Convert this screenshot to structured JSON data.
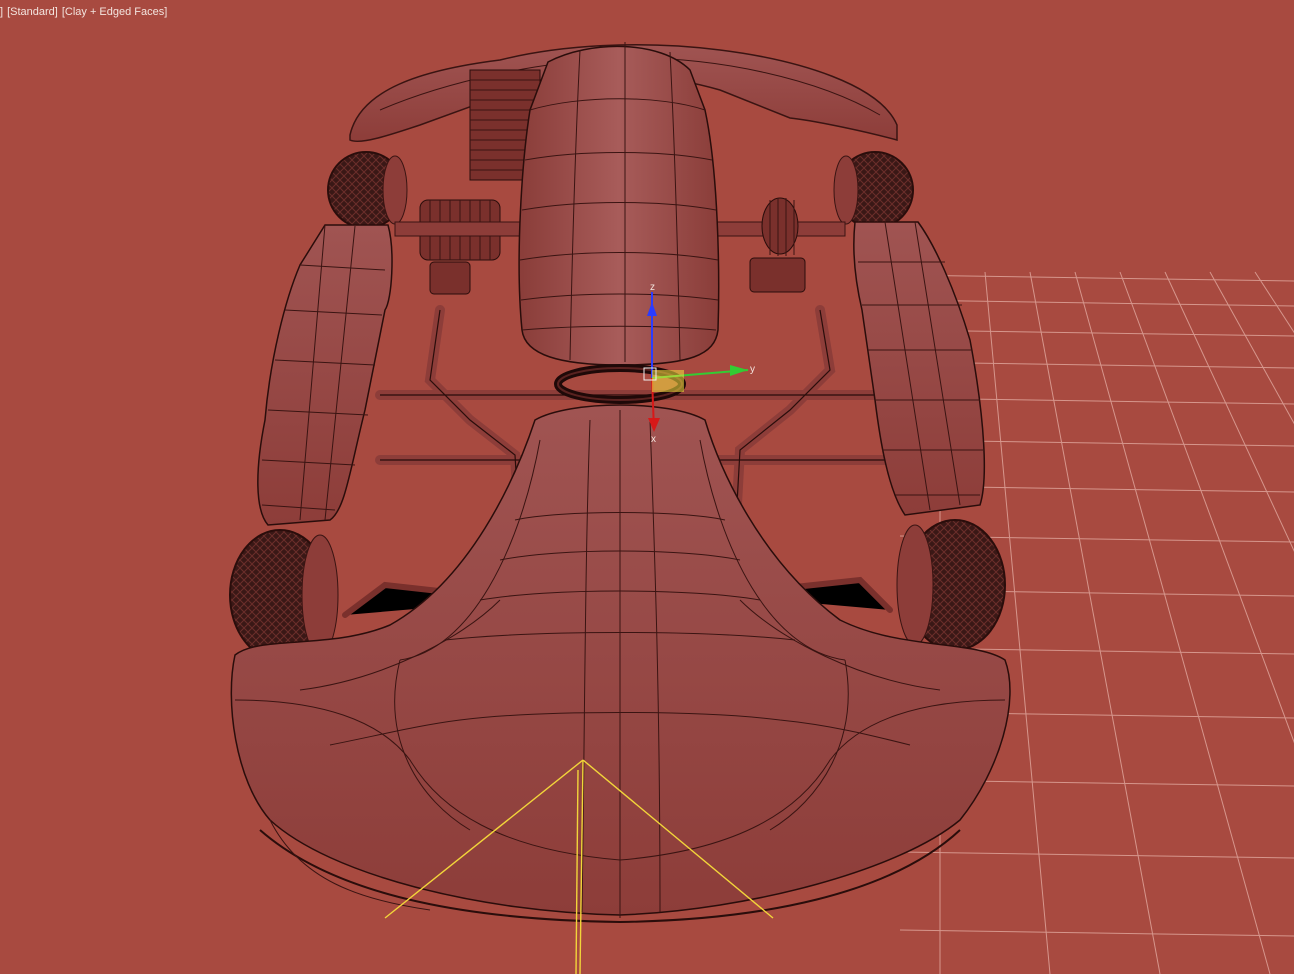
{
  "viewport": {
    "label_prefix": "]",
    "label_shading": "[Standard]",
    "label_style": "[Clay + Edged Faces]",
    "background_color": "#a84a40",
    "grid_color": "#d6968c",
    "model_color": "#9b4a44",
    "edge_color": "#3a1412"
  },
  "gizmo": {
    "axis_z": "z",
    "axis_y": "y",
    "axis_x": "x",
    "color_z": "#2b3cff",
    "color_y": "#33cc33",
    "color_x": "#d81818",
    "color_plane": "#f2e040"
  },
  "camera": {
    "frustum_color": "#f2d53a"
  },
  "model": {
    "name": "go-kart"
  }
}
